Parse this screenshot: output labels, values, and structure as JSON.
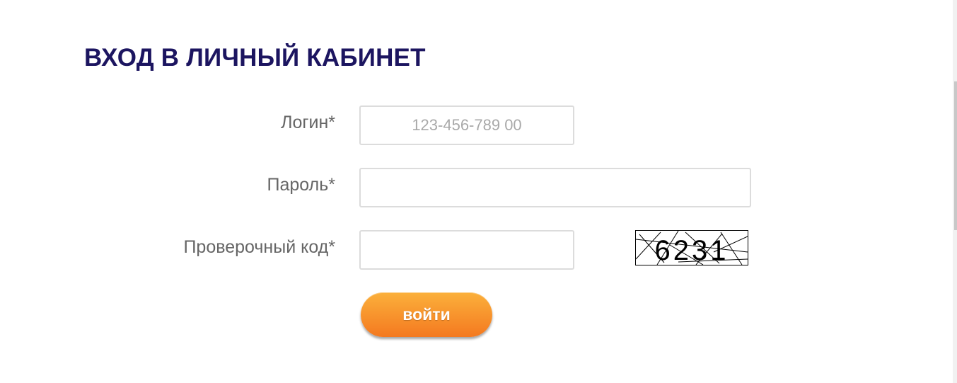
{
  "page": {
    "title": "ВХОД В ЛИЧНЫЙ КАБИНЕТ"
  },
  "form": {
    "login": {
      "label": "Логин*",
      "placeholder": "123-456-789 00",
      "value": ""
    },
    "password": {
      "label": "Пароль*",
      "value": ""
    },
    "captcha": {
      "label": "Проверочный код*",
      "value": "",
      "image_text": "6231"
    },
    "submit_label": "войти"
  },
  "colors": {
    "title": "#1c1560",
    "label": "#666666",
    "button_top": "#fbb03b",
    "button_bottom": "#f47920"
  }
}
